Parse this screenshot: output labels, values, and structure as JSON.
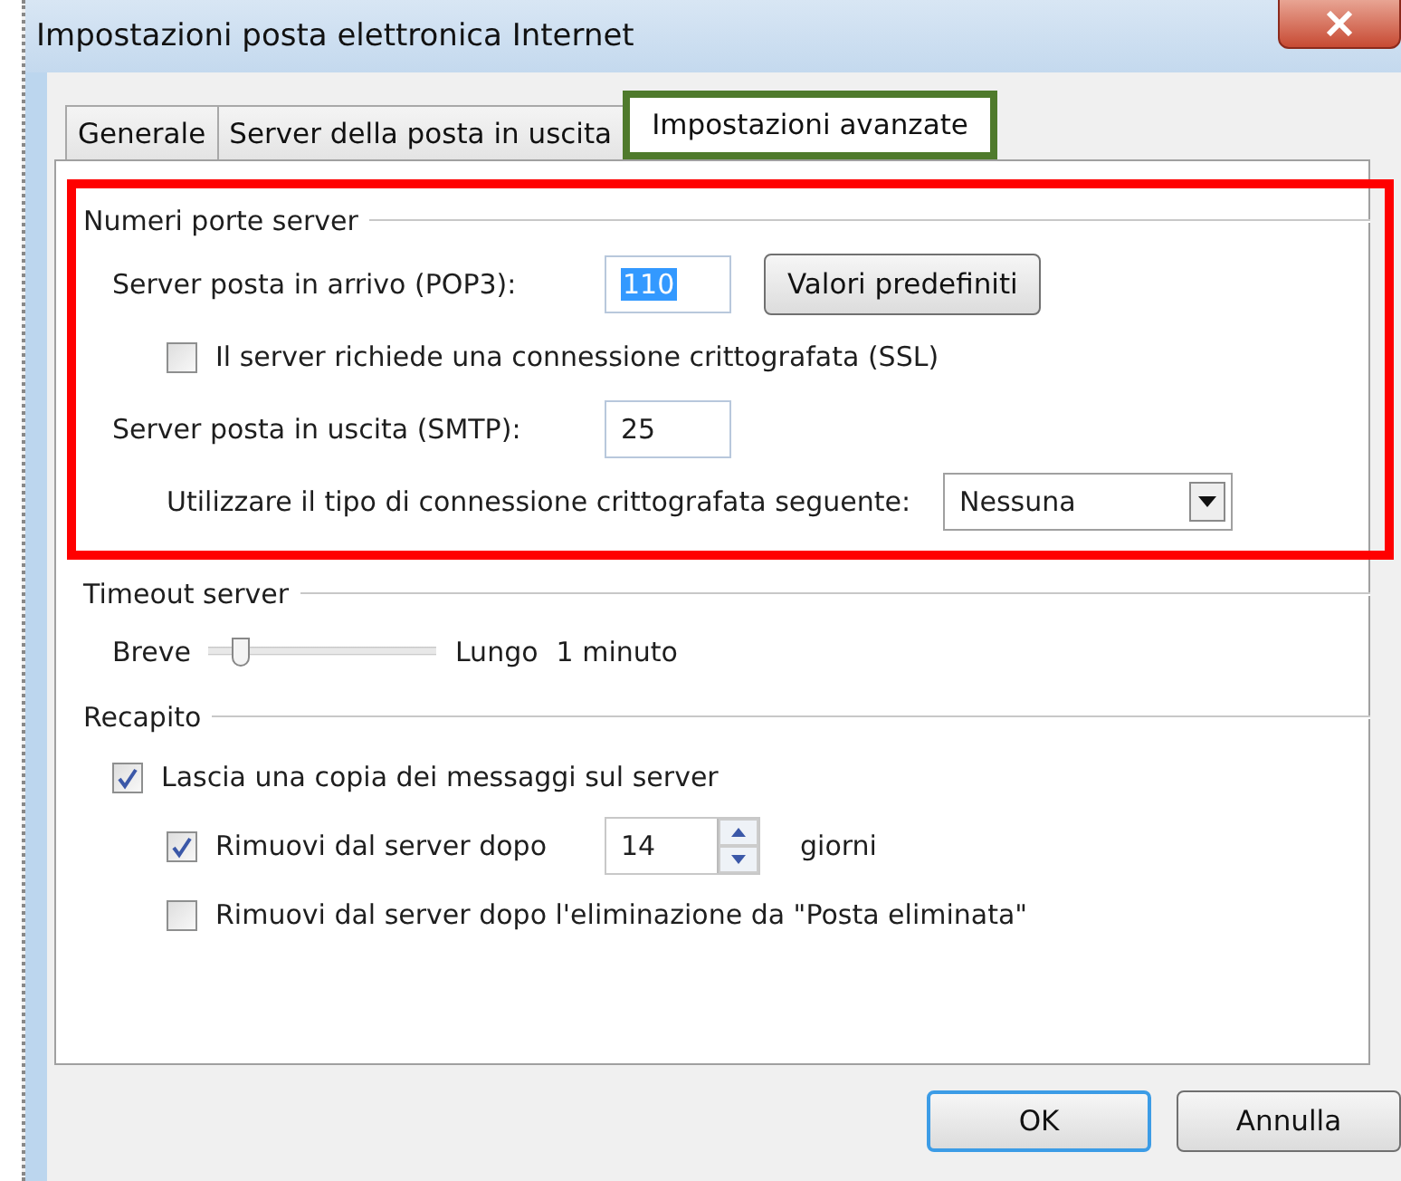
{
  "window": {
    "title": "Impostazioni posta elettronica Internet"
  },
  "tabs": [
    {
      "label": "Generale",
      "selected": false,
      "highlighted": false
    },
    {
      "label": "Server della posta in uscita",
      "selected": false,
      "highlighted": false
    },
    {
      "label": "Impostazioni avanzate",
      "selected": true,
      "highlighted": true
    }
  ],
  "ports": {
    "title": "Numeri porte server",
    "highlighted": true,
    "incoming": {
      "label": "Server posta in arrivo (POP3):",
      "value": "110",
      "value_selected": true
    },
    "defaults_button": "Valori predefiniti",
    "ssl": {
      "label": "Il server richiede una connessione crittografata (SSL)",
      "checked": false
    },
    "outgoing": {
      "label": "Server posta in uscita (SMTP):",
      "value": "25"
    },
    "encryption": {
      "label": "Utilizzare il tipo di connessione crittografata seguente:",
      "value": "Nessuna"
    }
  },
  "timeout": {
    "title": "Timeout server",
    "min_label": "Breve",
    "max_label": "Lungo",
    "level": 0.1,
    "reading": "1 minuto"
  },
  "delivery": {
    "title": "Recapito",
    "leave_copy": {
      "label": "Lascia una copia dei messaggi sul server",
      "checked": true
    },
    "remove_after": {
      "label": "Rimuovi dal server dopo",
      "checked": true,
      "value": "14",
      "unit": "giorni"
    },
    "remove_deleted": {
      "label": "Rimuovi dal server dopo l'eliminazione da \"Posta eliminata\"",
      "checked": false
    }
  },
  "buttons": [
    {
      "label": "OK",
      "default": true
    },
    {
      "label": "Annulla",
      "default": false
    }
  ]
}
